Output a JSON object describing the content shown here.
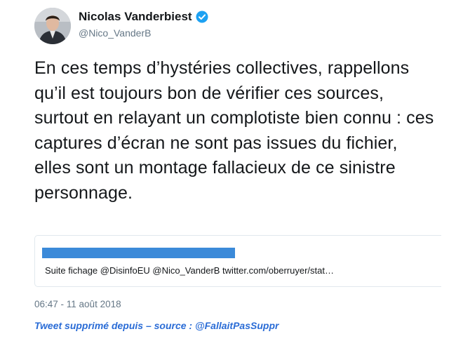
{
  "tweet": {
    "display_name": "Nicolas Vanderbiest",
    "handle": "@Nico_VanderB",
    "text": "En ces temps d’hystéries collectives, rappellons qu’il est toujours bon de vérifier ces sources, surtout en relayant un complotiste bien connu : ces captures d’écran ne sont pas issues du fichier, elles sont un montage fallacieux de ce sinistre personnage.",
    "timestamp": "06:47 - 11 août 2018",
    "verified_icon": "verified-badge-icon"
  },
  "quoted_card": {
    "text": "Suite fichage  @DisinfoEU @Nico_VanderB twitter.com/oberruyer/stat…",
    "redaction_color": "#3b8ad9"
  },
  "caption": "Tweet supprimé depuis – source : @FallaitPasSuppr",
  "colors": {
    "verified": "#1da1f2",
    "caption": "#2a6cd6"
  }
}
